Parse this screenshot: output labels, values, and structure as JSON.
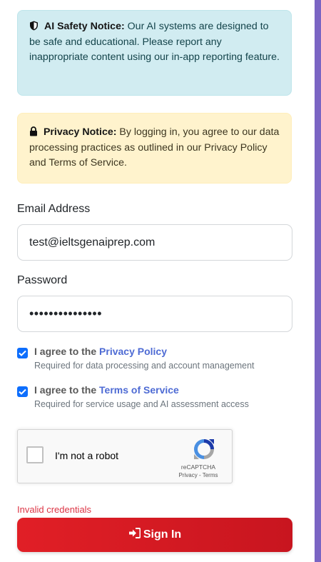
{
  "ai_notice": {
    "icon": "shield-icon",
    "title": "AI Safety Notice:",
    "body": " Our AI systems are designed to be safe and educational. Please report any inappropriate content using our in-app reporting feature."
  },
  "privacy_notice": {
    "icon": "lock-icon",
    "title": "Privacy Notice:",
    "body": " By logging in, you agree to our data processing practices as outlined in our Privacy Policy and Terms of Service."
  },
  "email": {
    "label": "Email Address",
    "value": "test@ieltsgenaiprep.com"
  },
  "password": {
    "label": "Password",
    "masked_value": "•••••••••••••••"
  },
  "consents": [
    {
      "prefix": "I agree to the ",
      "link": "Privacy Policy",
      "description": "Required for data processing and account management",
      "checked": true
    },
    {
      "prefix": "I agree to the ",
      "link": "Terms of Service",
      "description": "Required for service usage and AI assessment access",
      "checked": true
    }
  ],
  "recaptcha": {
    "label": "I'm not a robot",
    "brand": "reCAPTCHA",
    "links": "Privacy - Terms"
  },
  "error_message": "Invalid credentials",
  "submit": {
    "icon": "sign-in-icon",
    "label": "Sign In"
  },
  "colors": {
    "accent_purple": "#7a64c3",
    "submit_red": "#e11f26",
    "checkbox_blue": "#0d6efd",
    "link_blue": "#4e6bd4",
    "error_red": "#dc3545"
  }
}
